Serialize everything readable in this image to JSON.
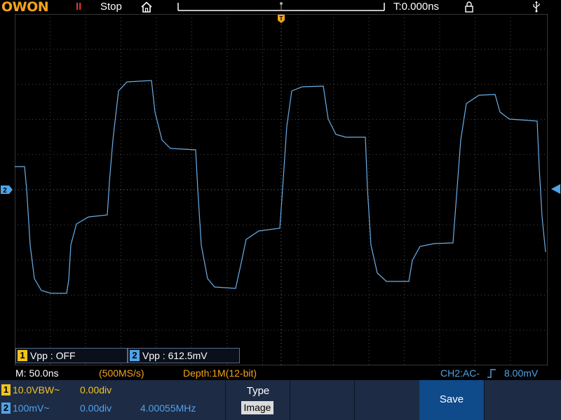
{
  "header": {
    "logo": "OWON",
    "run_icon": "II",
    "run_state": "Stop",
    "trigger_time": "T:0.000ns"
  },
  "measurements": [
    {
      "channel": "1",
      "text": "Vpp : OFF"
    },
    {
      "channel": "2",
      "text": "Vpp : 612.5mV"
    }
  ],
  "info": {
    "timebase": "M: 50.0ns",
    "sample_rate": "(500MS/s)",
    "depth": "Depth:1M(12-bit)",
    "trigger": "CH2:AC-",
    "trigger_level": "8.00mV"
  },
  "channels": [
    {
      "num": "1",
      "scale": "10.0V",
      "bw": "BW~",
      "offset": "0.00div",
      "freq": ""
    },
    {
      "num": "2",
      "scale": "100mV~",
      "bw": "",
      "offset": "0.00div",
      "freq": "4.00055MHz"
    }
  ],
  "menu": {
    "type_label": "Type",
    "type_value": "Image",
    "save_label": "Save"
  },
  "colors": {
    "ch1": "#f0c419",
    "ch2": "#4fa3e8",
    "trigger": "#f5a31a",
    "grid": "#5a5a5a",
    "menu_bg": "#1d2b45",
    "save_bg": "#0f4a8a"
  },
  "waveform_ch2": {
    "description_units": "divisions relative to center",
    "vertical_scale": "100mV/div",
    "horizontal_scale": "50.0ns/div"
  }
}
